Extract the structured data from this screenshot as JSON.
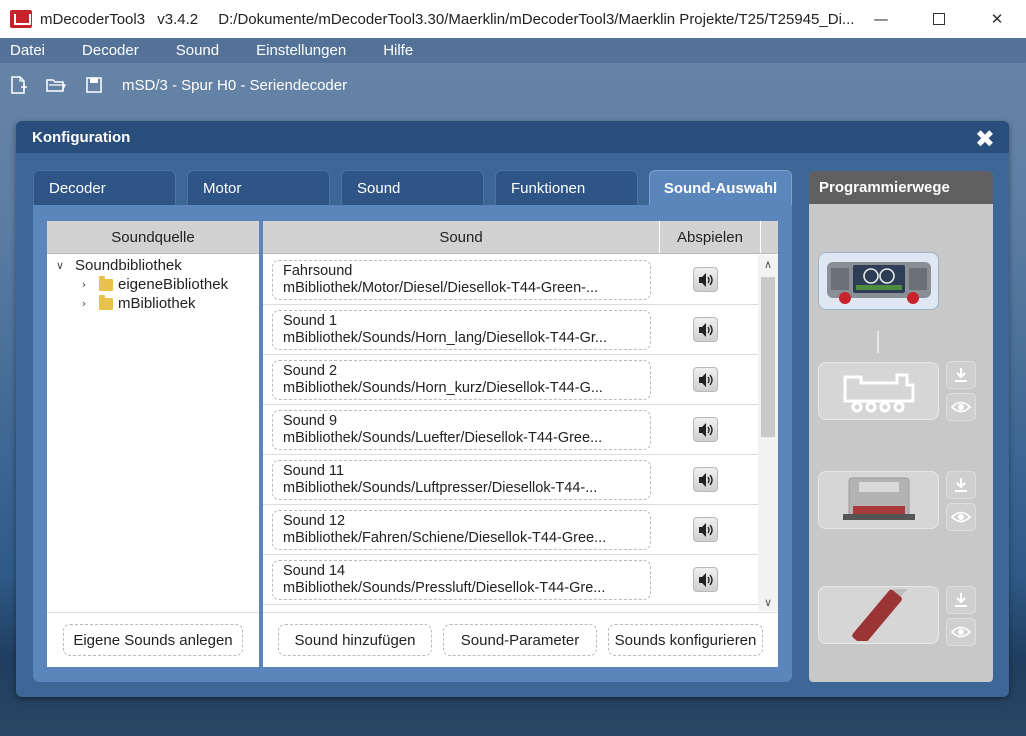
{
  "window": {
    "app_name": "mDecoderTool3",
    "version": "v3.4.2",
    "path": "D:/Dokumente/mDecoderTool3.30/Maerklin/mDecoderTool3/Maerklin Projekte/T25/T25945_Di..."
  },
  "menu": [
    "Datei",
    "Decoder",
    "Sound",
    "Einstellungen",
    "Hilfe"
  ],
  "toolbar": {
    "decoder_label": "mSD/3 - Spur H0 - Seriendecoder"
  },
  "config": {
    "title": "Konfiguration",
    "tabs": [
      "Decoder",
      "Motor",
      "Sound",
      "Funktionen",
      "Sound-Auswahl"
    ],
    "active_tab": "Sound-Auswahl"
  },
  "soundquelle": {
    "header": "Soundquelle",
    "root": "Soundbibliothek",
    "children": [
      "eigeneBibliothek",
      "mBibliothek"
    ],
    "footer_button": "Eigene Sounds anlegen"
  },
  "sound_table": {
    "header_sound": "Sound",
    "header_play": "Abspielen",
    "rows": [
      {
        "name": "Fahrsound",
        "path": "mBibliothek/Motor/Diesel/Diesellok-T44-Green-..."
      },
      {
        "name": "Sound 1",
        "path": "mBibliothek/Sounds/Horn_lang/Diesellok-T44-Gr..."
      },
      {
        "name": "Sound 2",
        "path": "mBibliothek/Sounds/Horn_kurz/Diesellok-T44-G..."
      },
      {
        "name": "Sound 9",
        "path": "mBibliothek/Sounds/Luefter/Diesellok-T44-Gree..."
      },
      {
        "name": "Sound 11",
        "path": "mBibliothek/Sounds/Luftpresser/Diesellok-T44-..."
      },
      {
        "name": "Sound 12",
        "path": "mBibliothek/Fahren/Schiene/Diesellok-T44-Gree..."
      },
      {
        "name": "Sound 14",
        "path": "mBibliothek/Sounds/Pressluft/Diesellok-T44-Gre..."
      }
    ],
    "buttons": [
      "Sound hinzufügen",
      "Sound-Parameter",
      "Sounds konfigurieren"
    ]
  },
  "programmierwege": {
    "title": "Programmierwege",
    "devices": [
      "central-station",
      "locomotive",
      "decoder-tester",
      "usb-programmer"
    ]
  },
  "colors": {
    "panel": "#3c6696",
    "tab_active": "#5b86bb",
    "header_gray": "#d2d2d2",
    "prog_header": "#5f5f5f",
    "accent_red": "#c8222a"
  }
}
